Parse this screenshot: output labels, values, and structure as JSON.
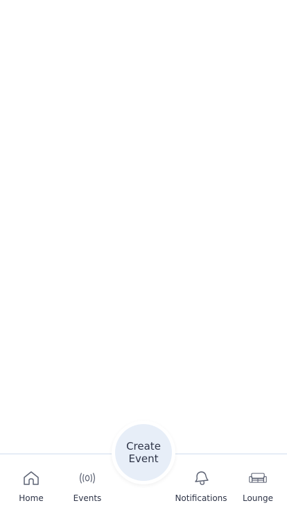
{
  "tabbar": {
    "items": [
      {
        "label": "Home",
        "icon": "home-icon"
      },
      {
        "label": "Events",
        "icon": "broadcast-icon"
      },
      {
        "label": "Notifications",
        "icon": "bell-icon"
      },
      {
        "label": "Lounge",
        "icon": "sofa-icon"
      }
    ],
    "create_event_label": "Create Event"
  },
  "colors": {
    "text": "#2e3447",
    "icon": "#5c6273",
    "fab_background": "#e7eef8",
    "divider": "#e6edf6",
    "background": "#ffffff"
  }
}
